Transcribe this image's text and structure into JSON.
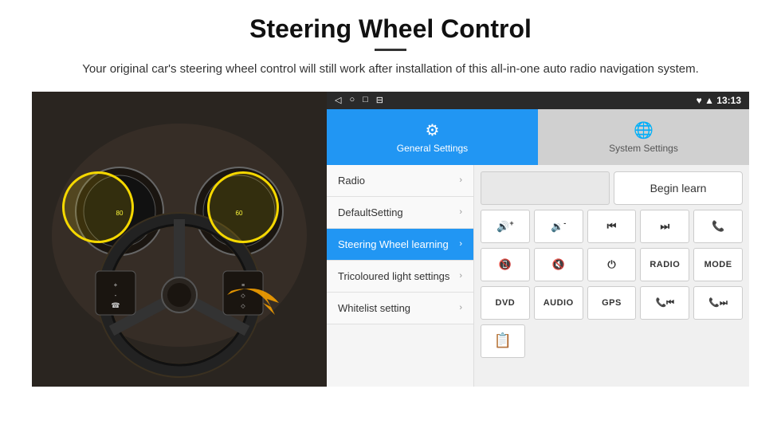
{
  "header": {
    "title": "Steering Wheel Control",
    "divider": true,
    "subtitle": "Your original car's steering wheel control will still work after installation of this all-in-one auto radio navigation system."
  },
  "android": {
    "statusBar": {
      "icons": [
        "◁",
        "○",
        "□",
        "⊟"
      ],
      "rightText": "♥ ▲  13:13"
    },
    "tabs": [
      {
        "id": "general",
        "label": "General Settings",
        "icon": "⚙",
        "active": true
      },
      {
        "id": "system",
        "label": "System Settings",
        "icon": "🌐",
        "active": false
      }
    ],
    "menuItems": [
      {
        "id": "radio",
        "label": "Radio",
        "active": false
      },
      {
        "id": "defaultsetting",
        "label": "DefaultSetting",
        "active": false
      },
      {
        "id": "steering",
        "label": "Steering Wheel learning",
        "active": true
      },
      {
        "id": "tricoloured",
        "label": "Tricoloured light settings",
        "active": false
      },
      {
        "id": "whitelist",
        "label": "Whitelist setting",
        "active": false
      }
    ],
    "controlPanel": {
      "beginLearnLabel": "Begin learn",
      "rows": [
        [
          {
            "id": "vol-up",
            "type": "icon",
            "content": "🔊+"
          },
          {
            "id": "vol-dn",
            "type": "icon",
            "content": "🔉-"
          },
          {
            "id": "prev-track",
            "type": "icon",
            "content": "⏮"
          },
          {
            "id": "next-track",
            "type": "icon",
            "content": "⏭"
          },
          {
            "id": "phone-call",
            "type": "icon",
            "content": "📞"
          }
        ],
        [
          {
            "id": "hang-up",
            "type": "icon",
            "content": "📵"
          },
          {
            "id": "mute",
            "type": "icon",
            "content": "🔇"
          },
          {
            "id": "power",
            "type": "icon",
            "content": "⏻"
          },
          {
            "id": "radio-btn",
            "type": "text",
            "content": "RADIO"
          },
          {
            "id": "mode-btn",
            "type": "text",
            "content": "MODE"
          }
        ],
        [
          {
            "id": "dvd-btn",
            "type": "text",
            "content": "DVD"
          },
          {
            "id": "audio-btn",
            "type": "text",
            "content": "AUDIO"
          },
          {
            "id": "gps-btn",
            "type": "text",
            "content": "GPS"
          },
          {
            "id": "call-prev",
            "type": "icon",
            "content": "📞⏮"
          },
          {
            "id": "call-next",
            "type": "icon",
            "content": "📞⏭"
          }
        ]
      ],
      "fileIcon": "📋"
    }
  }
}
